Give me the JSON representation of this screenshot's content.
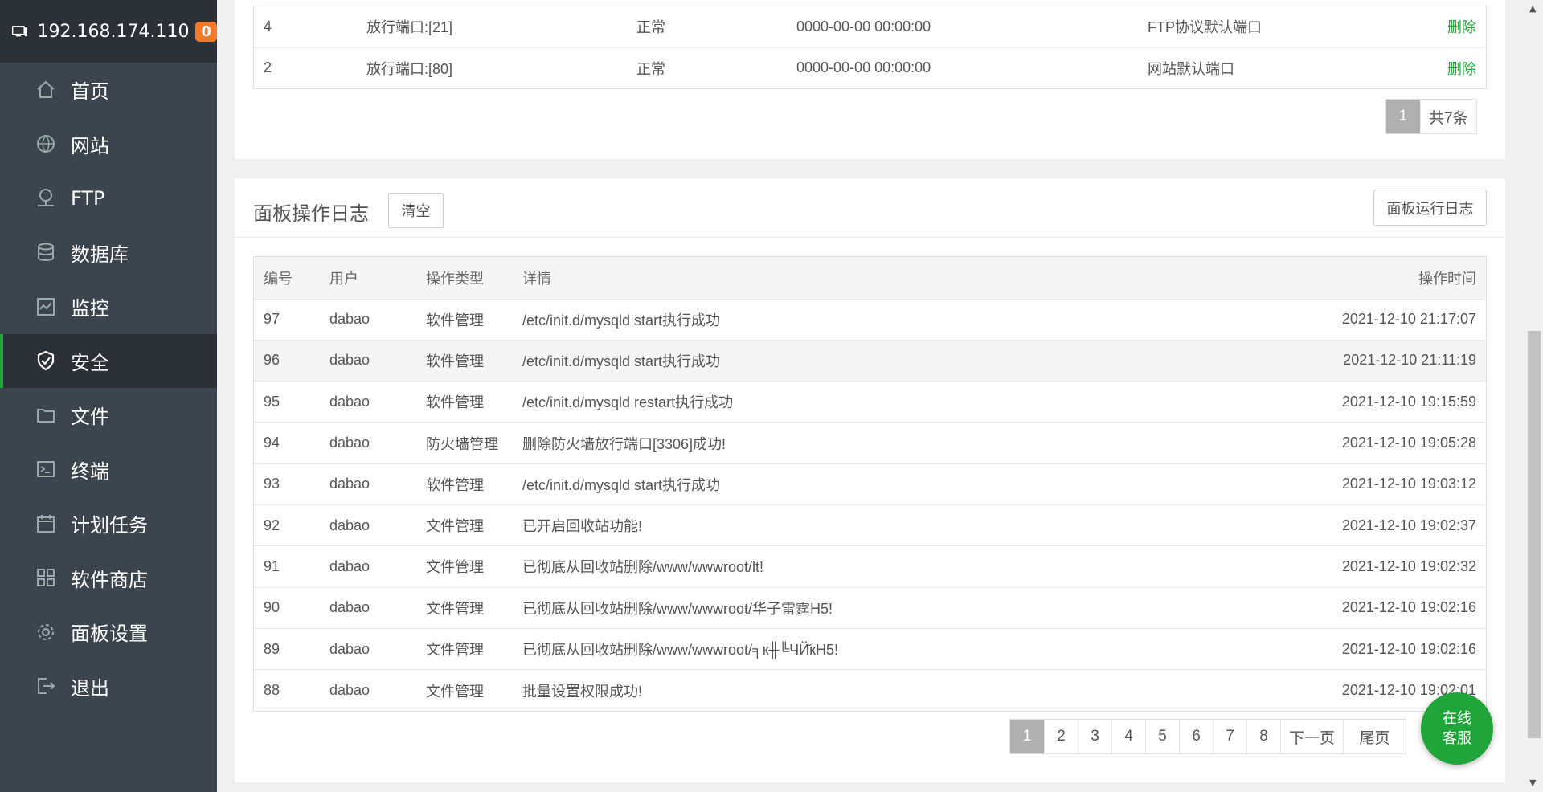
{
  "header": {
    "ip": "192.168.174.110",
    "badge": "0"
  },
  "menu": [
    {
      "label": "首页",
      "icon": "home-icon"
    },
    {
      "label": "网站",
      "icon": "globe-icon"
    },
    {
      "label": "FTP",
      "icon": "ftp-icon"
    },
    {
      "label": "数据库",
      "icon": "database-icon"
    },
    {
      "label": "监控",
      "icon": "monitor-icon"
    },
    {
      "label": "安全",
      "icon": "shield-icon",
      "active": true
    },
    {
      "label": "文件",
      "icon": "folder-icon"
    },
    {
      "label": "终端",
      "icon": "terminal-icon"
    },
    {
      "label": "计划任务",
      "icon": "calendar-icon"
    },
    {
      "label": "软件商店",
      "icon": "apps-icon"
    },
    {
      "label": "面板设置",
      "icon": "gear-icon"
    },
    {
      "label": "退出",
      "icon": "logout-icon"
    }
  ],
  "ports": {
    "rows": [
      {
        "id": "4",
        "rule": "放行端口:[21]",
        "status": "正常",
        "time": "0000-00-00 00:00:00",
        "note": "FTP协议默认端口",
        "action": "删除"
      },
      {
        "id": "2",
        "rule": "放行端口:[80]",
        "status": "正常",
        "time": "0000-00-00 00:00:00",
        "note": "网站默认端口",
        "action": "删除"
      }
    ],
    "pager": {
      "current": "1",
      "total": "共7条"
    }
  },
  "log": {
    "title": "面板操作日志",
    "clear_label": "清空",
    "run_log_label": "面板运行日志",
    "headers": {
      "id": "编号",
      "user": "用户",
      "type": "操作类型",
      "detail": "详情",
      "time": "操作时间"
    },
    "rows": [
      {
        "id": "97",
        "user": "dabao",
        "type": "软件管理",
        "detail": "/etc/init.d/mysqld start执行成功",
        "time": "2021-12-10 21:17:07"
      },
      {
        "id": "96",
        "user": "dabao",
        "type": "软件管理",
        "detail": "/etc/init.d/mysqld start执行成功",
        "time": "2021-12-10 21:11:19"
      },
      {
        "id": "95",
        "user": "dabao",
        "type": "软件管理",
        "detail": "/etc/init.d/mysqld restart执行成功",
        "time": "2021-12-10 19:15:59"
      },
      {
        "id": "94",
        "user": "dabao",
        "type": "防火墙管理",
        "detail": "删除防火墙放行端口[3306]成功!",
        "time": "2021-12-10 19:05:28"
      },
      {
        "id": "93",
        "user": "dabao",
        "type": "软件管理",
        "detail": "/etc/init.d/mysqld start执行成功",
        "time": "2021-12-10 19:03:12"
      },
      {
        "id": "92",
        "user": "dabao",
        "type": "文件管理",
        "detail": "已开启回收站功能!",
        "time": "2021-12-10 19:02:37"
      },
      {
        "id": "91",
        "user": "dabao",
        "type": "文件管理",
        "detail": "已彻底从回收站删除/www/wwwroot/lt!",
        "time": "2021-12-10 19:02:32"
      },
      {
        "id": "90",
        "user": "dabao",
        "type": "文件管理",
        "detail": "已彻底从回收站删除/www/wwwroot/华子雷霆H5!",
        "time": "2021-12-10 19:02:16"
      },
      {
        "id": "89",
        "user": "dabao",
        "type": "文件管理",
        "detail": "已彻底从回收站删除/www/wwwroot/╕к╫╚ЧЙ̆кH5!",
        "time": "2021-12-10 19:02:16"
      },
      {
        "id": "88",
        "user": "dabao",
        "type": "文件管理",
        "detail": "批量设置权限成功!",
        "time": "2021-12-10 19:02:01"
      }
    ],
    "pager": [
      "1",
      "2",
      "3",
      "4",
      "5",
      "6",
      "7",
      "8",
      "下一页",
      "尾页"
    ]
  },
  "chat": {
    "line1": "在线",
    "line2": "客服"
  }
}
